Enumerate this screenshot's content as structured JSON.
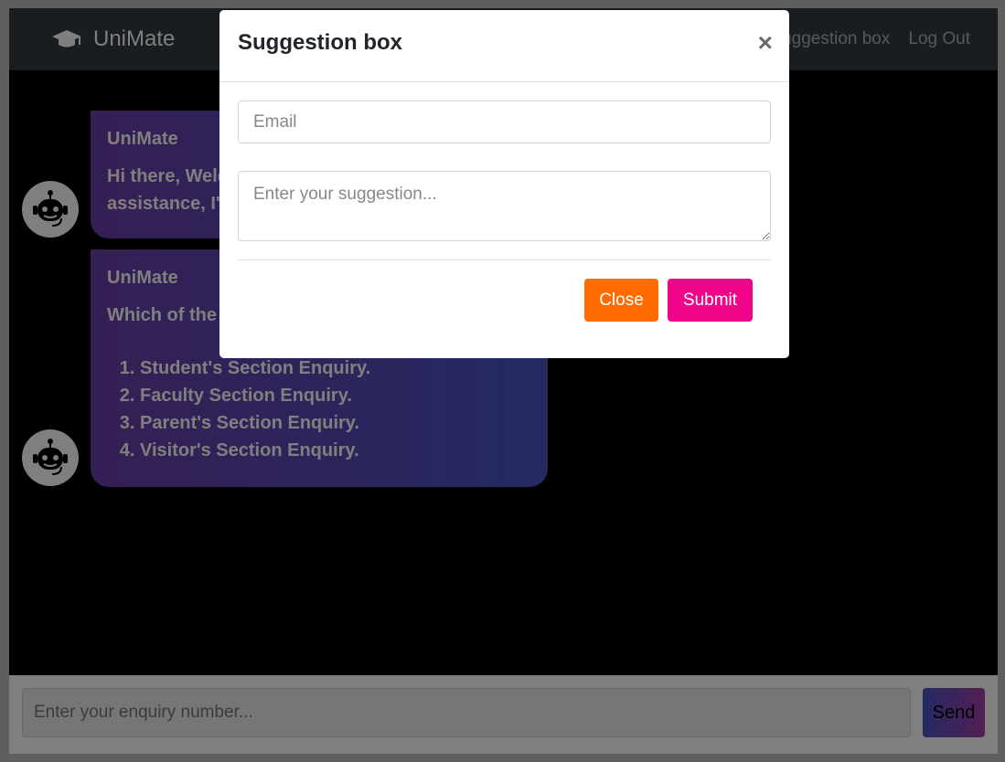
{
  "navbar": {
    "brand": "UniMate",
    "brand_icon": "graduation-cap-icon",
    "links": [
      "Suggestion box",
      "Log Out"
    ]
  },
  "chat": {
    "messages": [
      {
        "sender": "UniMate",
        "text": "Hi there, Welcome to UniMate, for your assistance, I'm here to help."
      },
      {
        "sender": "UniMate",
        "text": "Which of the following do you want?",
        "options": [
          "Student's Section Enquiry.",
          "Faculty Section Enquiry.",
          "Parent's Section Enquiry.",
          "Visitor's Section Enquiry."
        ]
      }
    ],
    "avatar_icon": "robot-icon"
  },
  "composer": {
    "placeholder": "Enter your enquiry number...",
    "send_label": "Send"
  },
  "modal": {
    "title": "Suggestion box",
    "close_symbol": "×",
    "email_placeholder": "Email",
    "suggestion_placeholder": "Enter your suggestion...",
    "close_label": "Close",
    "submit_label": "Submit"
  },
  "colors": {
    "navbar": "#343a40",
    "close_button": "#ff6d00",
    "submit_button": "#f0058a",
    "bubble_start": "#6a3ea8",
    "bubble_end": "#4a55c6"
  }
}
